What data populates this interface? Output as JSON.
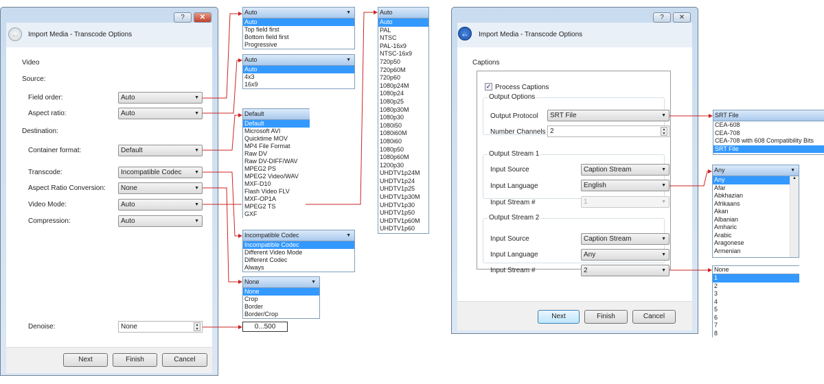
{
  "left_dialog": {
    "title": "Import Media - Transcode Options",
    "help_label": "?",
    "close_label": "✕",
    "section": "Video",
    "source": "Source:",
    "destination": "Destination:",
    "fields": [
      {
        "label": "Field order:",
        "value": "Auto"
      },
      {
        "label": "Aspect ratio:",
        "value": "Auto"
      },
      {
        "label": "Container format:",
        "value": "Default"
      },
      {
        "label": "Transcode:",
        "value": "Incompatible Codec"
      },
      {
        "label": "Aspect Ratio Conversion:",
        "value": "None"
      },
      {
        "label": "Video Mode:",
        "value": "Auto"
      },
      {
        "label": "Compression:",
        "value": "Auto"
      }
    ],
    "denoise": {
      "label": "Denoise:",
      "value": "None"
    },
    "buttons": {
      "next": "Next",
      "finish": "Finish",
      "cancel": "Cancel"
    }
  },
  "left_popups": [
    {
      "header": "Auto",
      "items": [
        "Auto",
        "Top field first",
        "Bottom field first",
        "Progressive"
      ],
      "selected": 0
    },
    {
      "header": "Auto",
      "items": [
        "Auto",
        "4x3",
        "16x9"
      ],
      "selected": 0
    },
    {
      "header": "Default",
      "items": [
        "Default",
        "Microsoft AVI",
        "Quicktime MOV",
        "MP4 File Format",
        "Raw DV",
        "Raw DV-DIFF/WAV",
        "MPEG2 PS",
        "MPEG2 Video/WAV",
        "MXF-D10",
        "Flash Video FLV",
        "MXF-OP1A",
        "MPEG2 TS",
        "GXF"
      ],
      "selected": 0
    },
    {
      "header": "Auto",
      "items": [
        "Auto",
        "PAL",
        "NTSC",
        "PAL-16x9",
        "NTSC-16x9",
        "720p50",
        "720p60M",
        "720p60",
        "1080p24M",
        "1080p24",
        "1080p25",
        "1080p30M",
        "1080p30",
        "1080i50",
        "1080i60M",
        "1080i60",
        "1080p50",
        "1080p60M",
        "1200p30",
        "UHDTV1p24M",
        "UHDTV1p24",
        "UHDTV1p25",
        "UHDTV1p30M",
        "UHDTV1p30",
        "UHDTV1p50",
        "UHDTV1p60M",
        "UHDTV1p60"
      ],
      "selected": 0
    },
    {
      "header": "Incompatible Codec",
      "items": [
        "Incompatible Codec",
        "Different Video Mode",
        "Different Codec",
        "Always"
      ],
      "selected": 0
    },
    {
      "header": "None",
      "items": [
        "None",
        "Crop",
        "Border",
        "Border/Crop"
      ],
      "selected": 0
    }
  ],
  "denoise_range": "0...500",
  "right_dialog": {
    "title": "Import Media - Transcode Options",
    "help_label": "?",
    "close_label": "✕",
    "section": "Captions",
    "process_captions": {
      "label": "Process Captions",
      "checked": true
    },
    "output_options": {
      "legend": "Output Options",
      "protocol_label": "Output Protocol",
      "protocol_value": "SRT File",
      "channels_label": "Number Channels",
      "channels_value": "2"
    },
    "stream1": {
      "legend": "Output Stream 1",
      "source_label": "Input Source",
      "source_value": "Caption Stream",
      "language_label": "Input Language",
      "language_value": "English",
      "stream_label": "Input Stream #",
      "stream_value": "1"
    },
    "stream2": {
      "legend": "Output Stream 2",
      "source_label": "Input Source",
      "source_value": "Caption Stream",
      "language_label": "Input Language",
      "language_value": "Any",
      "stream_label": "Input Stream #",
      "stream_value": "2"
    },
    "buttons": {
      "next": "Next",
      "finish": "Finish",
      "cancel": "Cancel"
    }
  },
  "right_popups": {
    "protocol": {
      "header": "SRT File",
      "items": [
        "CEA-608",
        "CEA-708",
        "CEA-708 with 608 Compatibility Bits",
        "SRT File"
      ],
      "selected": 3
    },
    "language": {
      "header": "Any",
      "items": [
        "Any",
        "Afar",
        "Abkhazian",
        "Afrikaans",
        "Akan",
        "Albanian",
        "Amharic",
        "Arabic",
        "Aragonese",
        "Armenian"
      ],
      "selected": 0
    },
    "stream": {
      "header": "None",
      "items": [
        "1",
        "2",
        "3",
        "4",
        "5",
        "6",
        "7",
        "8"
      ],
      "selected": 0
    }
  },
  "colors": {
    "connector": "#cc2222",
    "selection": "#3399ff"
  }
}
